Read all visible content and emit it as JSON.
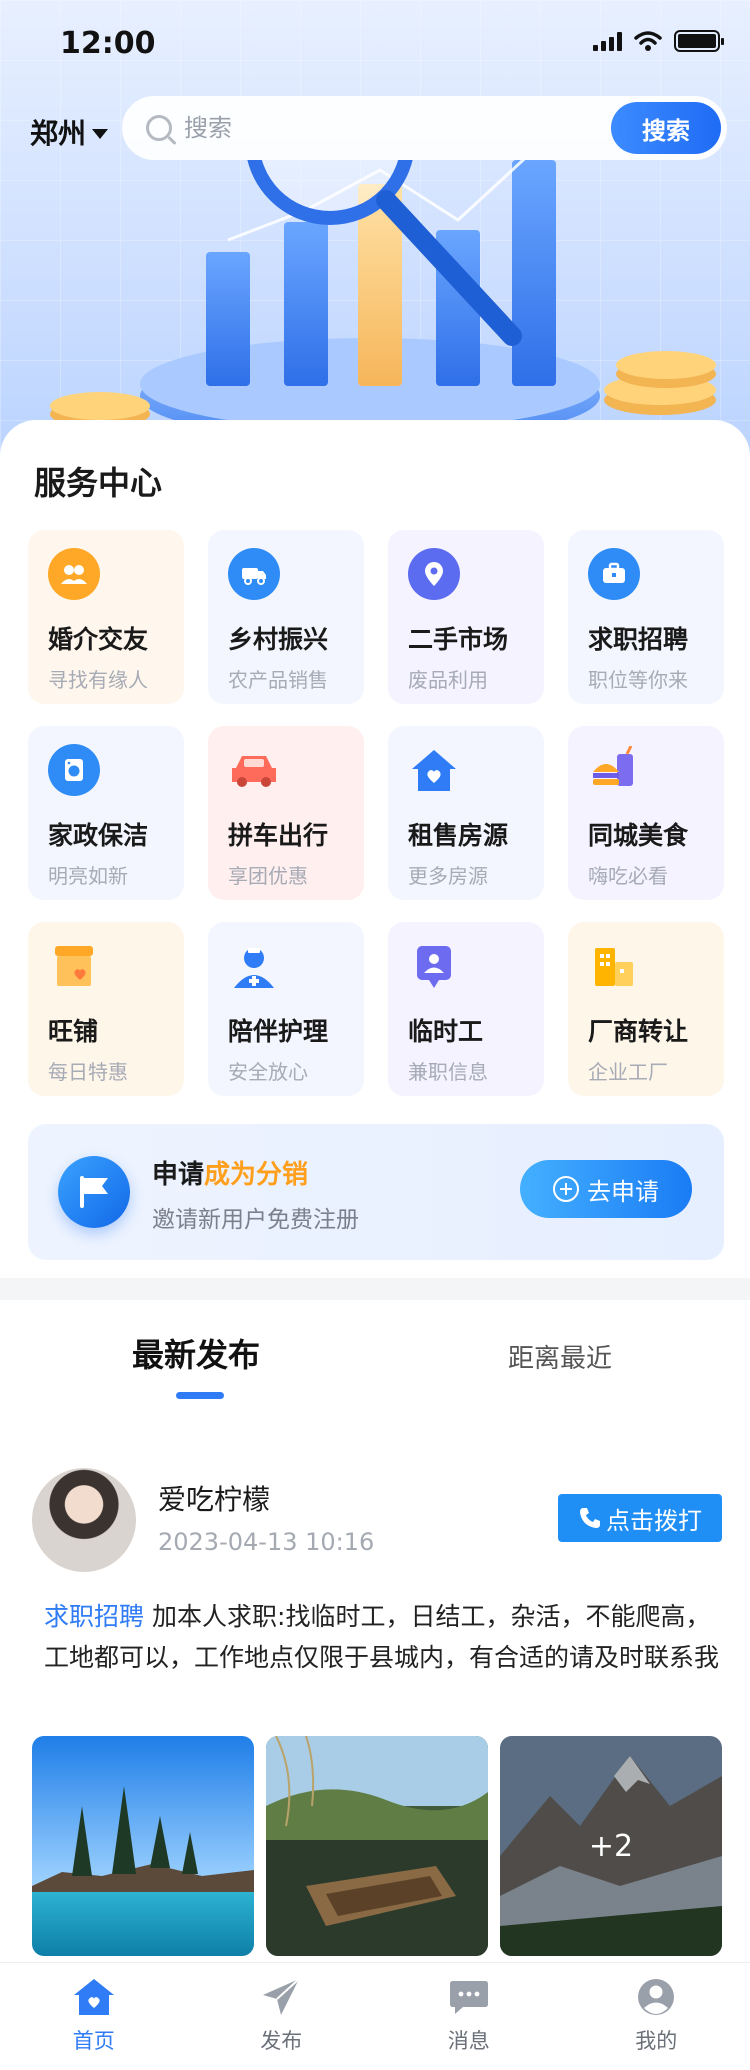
{
  "status": {
    "time": "12:00"
  },
  "header": {
    "city": "郑州",
    "search_placeholder": "搜索",
    "search_button": "搜索"
  },
  "service": {
    "title": "服务中心",
    "items": [
      {
        "title": "婚介交友",
        "subtitle": "寻找有缘人",
        "icon": "people-icon",
        "color": "#ffa726"
      },
      {
        "title": "乡村振兴",
        "subtitle": "农产品销售",
        "icon": "truck-icon",
        "color": "#2f7cf6"
      },
      {
        "title": "二手市场",
        "subtitle": "废品利用",
        "icon": "location-pin-icon",
        "color": "#5b6cf0"
      },
      {
        "title": "求职招聘",
        "subtitle": "职位等你来",
        "icon": "briefcase-icon",
        "color": "#2f8cf6"
      },
      {
        "title": "家政保洁",
        "subtitle": "明亮如新",
        "icon": "washing-machine-icon",
        "color": "#2f8cf6"
      },
      {
        "title": "拼车出行",
        "subtitle": "享团优惠",
        "icon": "car-icon",
        "color": "#ff6b5b"
      },
      {
        "title": "租售房源",
        "subtitle": "更多房源",
        "icon": "house-heart-icon",
        "color": "#2f7cf6"
      },
      {
        "title": "同城美食",
        "subtitle": "嗨吃必看",
        "icon": "burger-drink-icon",
        "color": "#7b6cf0"
      },
      {
        "title": "旺铺",
        "subtitle": "每日特惠",
        "icon": "shop-icon",
        "color": "#ffa726"
      },
      {
        "title": "陪伴护理",
        "subtitle": "安全放心",
        "icon": "nurse-icon",
        "color": "#2f7cf6"
      },
      {
        "title": "临时工",
        "subtitle": "兼职信息",
        "icon": "id-badge-icon",
        "color": "#6d6cf0"
      },
      {
        "title": "厂商转让",
        "subtitle": "企业工厂",
        "icon": "factory-icon",
        "color": "#ffb400"
      }
    ]
  },
  "promo": {
    "prefix": "申请",
    "highlight": "成为分销",
    "subtitle": "邀请新用户免费注册",
    "button": "去申请"
  },
  "feed": {
    "tabs": [
      "最新发布",
      "距离最近"
    ],
    "post": {
      "username": "爱吃柠檬",
      "time": "2023-04-13 10:16",
      "call_button": "点击拨打",
      "category": "求职招聘",
      "content": "加本人求职:找临时工，日结工，杂活，不能爬高，工地都可以，工作地点仅限于县城内，有合适的请及时联系我",
      "more_photos": "+2"
    }
  },
  "tabbar": {
    "items": [
      {
        "label": "首页",
        "icon": "home-heart-icon",
        "active": true
      },
      {
        "label": "发布",
        "icon": "send-icon",
        "active": false
      },
      {
        "label": "消息",
        "icon": "chat-icon",
        "active": false
      },
      {
        "label": "我的",
        "icon": "profile-icon",
        "active": false
      }
    ]
  },
  "colors": {
    "accent": "#2f7cf6",
    "highlight": "#ff9f1c",
    "call": "#1f8ef5"
  }
}
